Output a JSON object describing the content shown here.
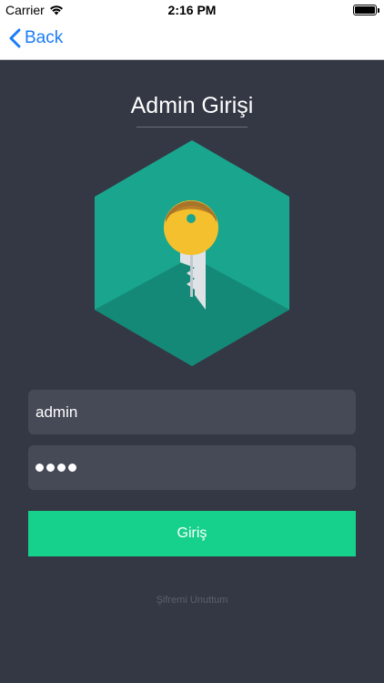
{
  "status_bar": {
    "carrier": "Carrier",
    "time": "2:16 PM",
    "icons": [
      "wifi-icon",
      "battery-icon"
    ]
  },
  "nav": {
    "back_label": "Back",
    "icon": "chevron-left-icon"
  },
  "page": {
    "title": "Admin Girişi"
  },
  "logo": {
    "icon": "key-hexagon-icon",
    "colors": {
      "hexagon": "#1aa58e",
      "hexagon_shadow": "#148977",
      "key_head": "#f5c02d",
      "key_blade": "#dfe3e6"
    }
  },
  "form": {
    "username_value": "admin",
    "password_mask": "••••",
    "password_length": 4,
    "submit_label": "Giriş",
    "forgot_label": "Şifremi Unuttum"
  },
  "colors": {
    "background": "#343844",
    "field_background": "#464a56",
    "accent": "#16d18c",
    "link": "#1a7cf6"
  }
}
